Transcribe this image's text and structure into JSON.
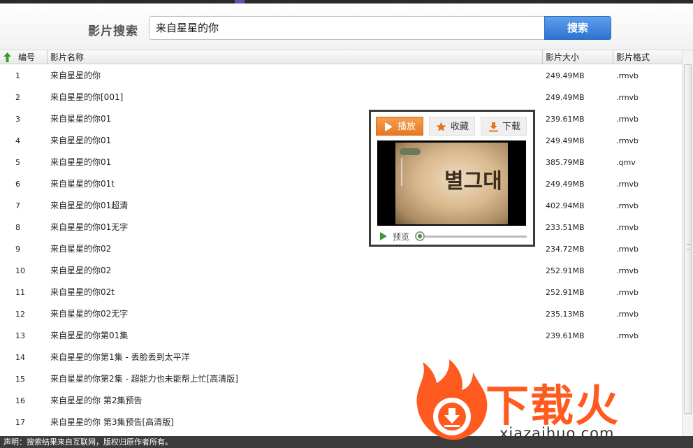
{
  "search": {
    "label": "影片搜索",
    "query": "来自星星的你",
    "button_label": "搜索"
  },
  "table": {
    "headers": {
      "number": "编号",
      "name": "影片名称",
      "size": "影片大小",
      "format": "影片格式"
    },
    "rows": [
      {
        "num": "1",
        "name": "来自星星的你",
        "size": "249.49MB",
        "format": ".rmvb"
      },
      {
        "num": "2",
        "name": "来自星星的你[001]",
        "size": "249.49MB",
        "format": ".rmvb"
      },
      {
        "num": "3",
        "name": "来自星星的你01",
        "size": "239.61MB",
        "format": ".rmvb"
      },
      {
        "num": "4",
        "name": "来自星星的你01",
        "size": "249.49MB",
        "format": ".rmvb"
      },
      {
        "num": "5",
        "name": "来自星星的你01",
        "size": "385.79MB",
        "format": ".qmv"
      },
      {
        "num": "6",
        "name": "来自星星的你01t",
        "size": "249.49MB",
        "format": ".rmvb"
      },
      {
        "num": "7",
        "name": "来自星星的你01超清",
        "size": "402.94MB",
        "format": ".rmvb"
      },
      {
        "num": "8",
        "name": "来自星星的你01无字",
        "size": "233.51MB",
        "format": ".rmvb"
      },
      {
        "num": "9",
        "name": "来自星星的你02",
        "size": "234.72MB",
        "format": ".rmvb"
      },
      {
        "num": "10",
        "name": "来自星星的你02",
        "size": "252.91MB",
        "format": ".rmvb"
      },
      {
        "num": "11",
        "name": "来自星星的你02t",
        "size": "252.91MB",
        "format": ".rmvb"
      },
      {
        "num": "12",
        "name": "来自星星的你02无字",
        "size": "235.13MB",
        "format": ".rmvb"
      },
      {
        "num": "13",
        "name": "来自星星的你第01集",
        "size": "239.61MB",
        "format": ".rmvb"
      },
      {
        "num": "14",
        "name": "来自星星的你第1集 - 丢脸丢到太平洋",
        "size": "",
        "format": ""
      },
      {
        "num": "15",
        "name": "来自星星的你第2集 - 超能力也未能帮上忙[高清版]",
        "size": "",
        "format": ""
      },
      {
        "num": "16",
        "name": "来自星星的你 第2集预告",
        "size": "",
        "format": ""
      },
      {
        "num": "17",
        "name": "来自星星的你 第3集预告[高清版]",
        "size": "",
        "format": ""
      }
    ]
  },
  "preview": {
    "play_label": "播放",
    "favorite_label": "收藏",
    "download_label": "下载",
    "preview_label": "预览",
    "progress": 0.0
  },
  "status": {
    "text": "声明：搜索结果来自互联网，版权归原作者所有。"
  },
  "watermark": {
    "brand": "下载火",
    "url": "xiazaihuo.com"
  },
  "colors": {
    "accent_blue": "#2d73cf",
    "play_orange": "#e87722",
    "watermark_orange": "#ff5a1f"
  }
}
